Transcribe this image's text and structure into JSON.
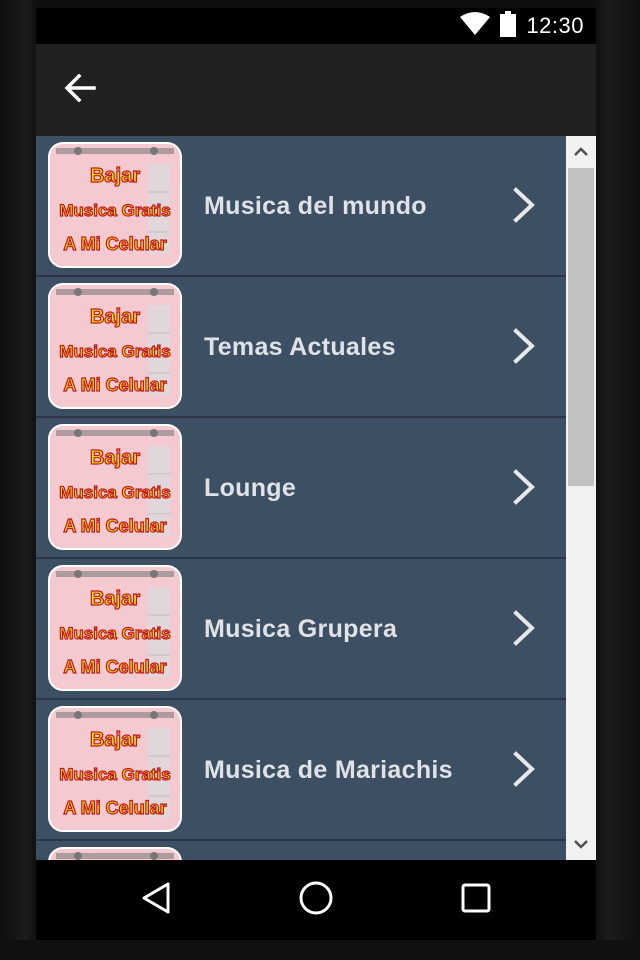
{
  "status_bar": {
    "time": "12:30",
    "icons": [
      "wifi-icon",
      "battery-icon"
    ]
  },
  "app_bar": {
    "back_icon": "arrow-left-icon"
  },
  "thumbnail": {
    "line1": "Bajar",
    "line2": "Musica Gratis",
    "line3": "A Mi Celular"
  },
  "list": {
    "items": [
      {
        "label": "Musica del mundo"
      },
      {
        "label": "Temas Actuales"
      },
      {
        "label": "Lounge"
      },
      {
        "label": "Musica Grupera"
      },
      {
        "label": "Musica de Mariachis"
      },
      {
        "label": ""
      }
    ],
    "chevron_icon": "chevron-right-icon"
  },
  "scrollbar": {
    "up_icon": "scroll-up-arrow-icon",
    "down_icon": "scroll-down-arrow-icon"
  },
  "nav_bar": {
    "back_icon": "triangle-back-icon",
    "home_icon": "circle-home-icon",
    "recents_icon": "square-recents-icon"
  },
  "colors": {
    "list_row": "#3d4f62",
    "app_bar": "#212121",
    "label_text": "#dfe3e8",
    "thumb_text": "#ffe600",
    "thumb_bg": "#f4c9cf"
  }
}
